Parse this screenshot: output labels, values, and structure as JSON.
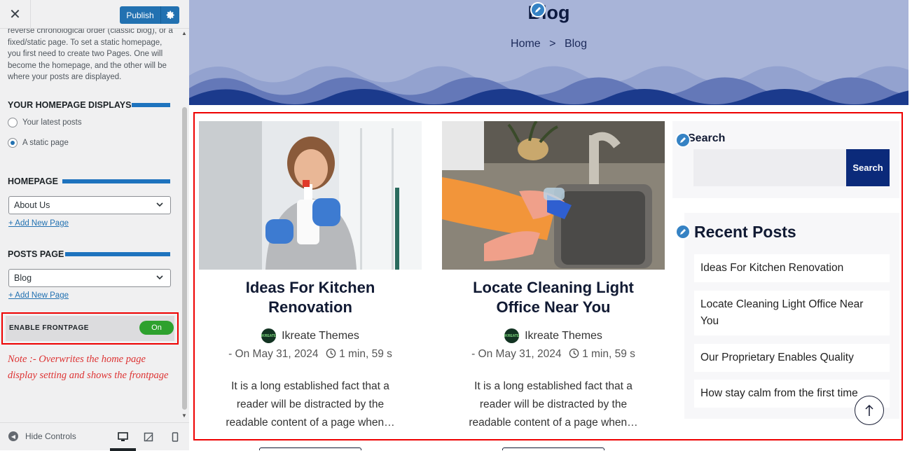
{
  "customizer": {
    "close_glyph": "✕",
    "publish_label": "Publish",
    "description": "reverse chronological order (classic blog), or a fixed/static page. To set a static homepage, you first need to create two Pages. One will become the homepage, and the other will be where your posts are displayed.",
    "homepage_displays": {
      "title": "YOUR HOMEPAGE DISPLAYS",
      "options": [
        {
          "label": "Your latest posts",
          "checked": false
        },
        {
          "label": "A static page",
          "checked": true
        }
      ]
    },
    "homepage": {
      "title": "HOMEPAGE",
      "selected": "About Us",
      "add_link": "+ Add New Page"
    },
    "posts_page": {
      "title": "POSTS PAGE",
      "selected": "Blog",
      "add_link": "+ Add New Page"
    },
    "enable_frontpage": {
      "label": "ENABLE FRONTPAGE",
      "toggle_label": "On",
      "enabled": true
    },
    "note": "Note :- Overwrites the home page display setting and shows the frontpage",
    "footer": {
      "hide_controls": "Hide Controls",
      "active_device": "desktop"
    }
  },
  "preview": {
    "hero": {
      "title": "Blog",
      "breadcrumb": {
        "home": "Home",
        "separator": ">",
        "current": "Blog"
      }
    },
    "posts": [
      {
        "title": "Ideas For Kitchen Renovation",
        "author": "Ikreate Themes",
        "date": "- On May 31, 2024",
        "read_time": "1 min, 59 s",
        "excerpt": "It is a long established fact that a reader will be distracted by the readable content of a page when…"
      },
      {
        "title": "Locate Cleaning Light Office Near You",
        "author": "Ikreate Themes",
        "date": "- On May 31, 2024",
        "read_time": "1 min, 59 s",
        "excerpt": "It is a long established fact that a reader will be distracted by the readable content of a page when…"
      }
    ],
    "search_widget": {
      "title": "Search",
      "button": "Search"
    },
    "recent_posts": {
      "title": "Recent Posts",
      "items": [
        "Ideas For Kitchen Renovation",
        "Locate Cleaning Light Office Near You",
        "Our Proprietary Enables Quality",
        "How stay calm from the first time"
      ]
    }
  },
  "colors": {
    "accent": "#2271b1",
    "highlight": "#e00000",
    "toggle_on": "#2ea12e",
    "brand_dark": "#0b2a7a"
  }
}
